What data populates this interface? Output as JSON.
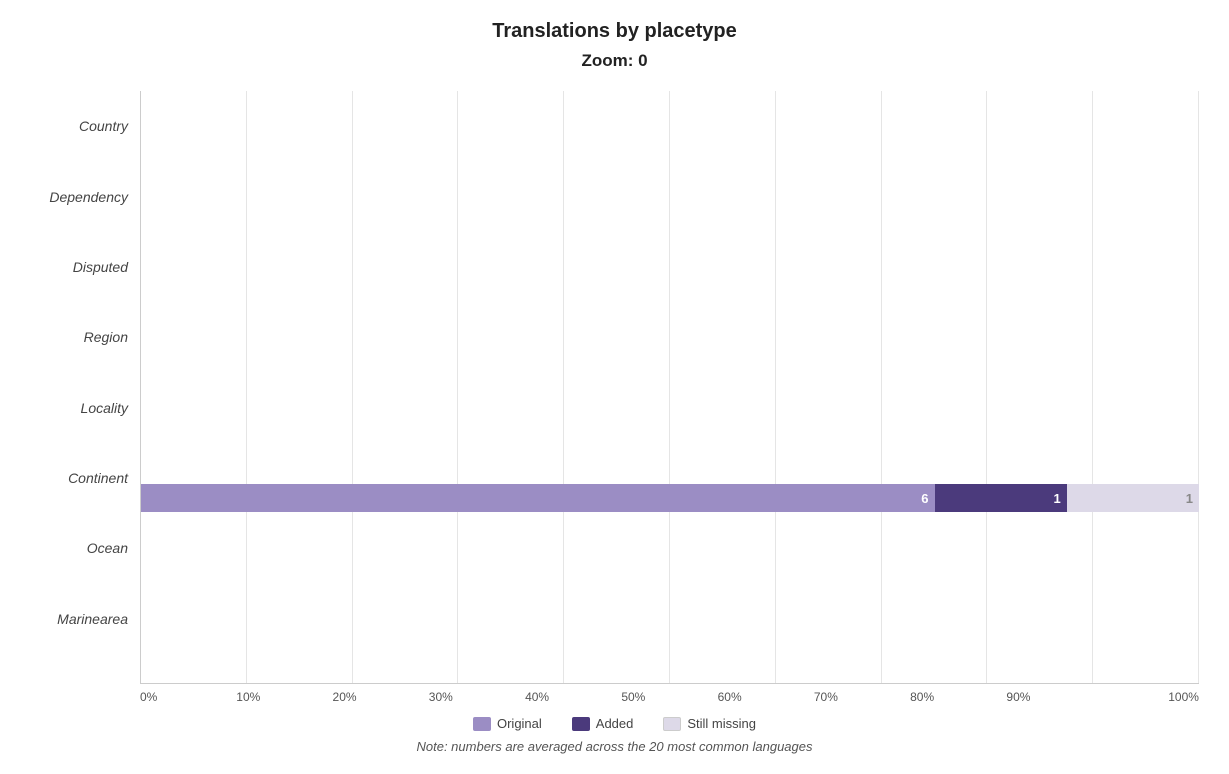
{
  "title": "Translations by placetype",
  "subtitle": "Zoom: 0",
  "y_labels": [
    "Country",
    "Dependency",
    "Disputed",
    "Region",
    "Locality",
    "Continent",
    "Ocean",
    "Marinearea"
  ],
  "bars": [
    {
      "id": "country",
      "original_pct": 0,
      "added_pct": 0,
      "missing_pct": 0,
      "original_val": null,
      "added_val": null,
      "missing_val": null
    },
    {
      "id": "dependency",
      "original_pct": 0,
      "added_pct": 0,
      "missing_pct": 0,
      "original_val": null,
      "added_val": null,
      "missing_val": null
    },
    {
      "id": "disputed",
      "original_pct": 0,
      "added_pct": 0,
      "missing_pct": 0,
      "original_val": null,
      "added_val": null,
      "missing_val": null
    },
    {
      "id": "region",
      "original_pct": 0,
      "added_pct": 0,
      "missing_pct": 0,
      "original_val": null,
      "added_val": null,
      "missing_val": null
    },
    {
      "id": "locality",
      "original_pct": 0,
      "added_pct": 0,
      "missing_pct": 0,
      "original_val": null,
      "added_val": null,
      "missing_val": null
    },
    {
      "id": "continent",
      "original_pct": 75,
      "added_pct": 12.5,
      "missing_pct": 12.5,
      "original_val": "6",
      "added_val": "1",
      "missing_val": "1"
    },
    {
      "id": "ocean",
      "original_pct": 0,
      "added_pct": 0,
      "missing_pct": 0,
      "original_val": null,
      "added_val": null,
      "missing_val": null
    },
    {
      "id": "marinearea",
      "original_pct": 0,
      "added_pct": 0,
      "missing_pct": 0,
      "original_val": null,
      "added_val": null,
      "missing_val": null
    }
  ],
  "x_ticks": [
    "0%",
    "10%",
    "20%",
    "30%",
    "40%",
    "50%",
    "60%",
    "70%",
    "80%",
    "90%",
    "100%"
  ],
  "legend": {
    "original_label": "Original",
    "added_label": "Added",
    "missing_label": "Still missing"
  },
  "note": "Note: numbers are averaged across the 20 most common languages",
  "colors": {
    "original": "#9b8dc4",
    "added": "#4b3a7c",
    "missing": "#ddd9e8"
  }
}
